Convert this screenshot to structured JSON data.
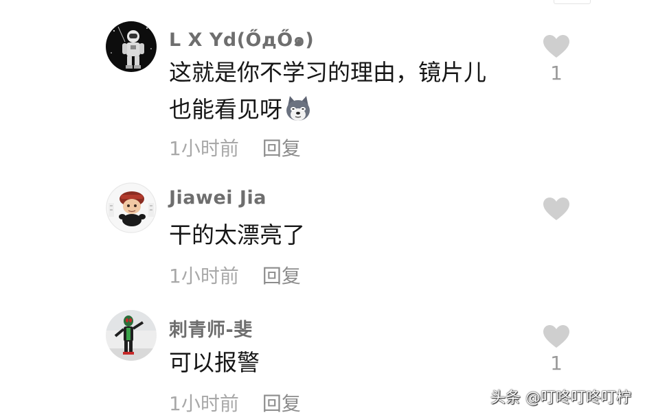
{
  "comments": [
    {
      "username": "L X Yd(ŐдŐ๑)",
      "text_line1": "这就是你不学习的理由，镜片儿",
      "text_line2": "也能看见呀",
      "emoji": "dog-face-emoji",
      "time": "1小时前",
      "reply_label": "回复",
      "likes": "1"
    },
    {
      "username": "Jiawei Jia",
      "text_line1": "干的太漂亮了",
      "time": "1小时前",
      "reply_label": "回复",
      "likes": ""
    },
    {
      "username": "刺青师-斐",
      "text_line1": "可以报警",
      "time": "1小时前",
      "reply_label": "回复",
      "likes": "1"
    }
  ],
  "watermark": "头条 @叮咚叮咚叮柠",
  "colors": {
    "username": "#6e6e6e",
    "text": "#161616",
    "meta": "#a8a8a8",
    "heart": "#cfcfcf"
  }
}
